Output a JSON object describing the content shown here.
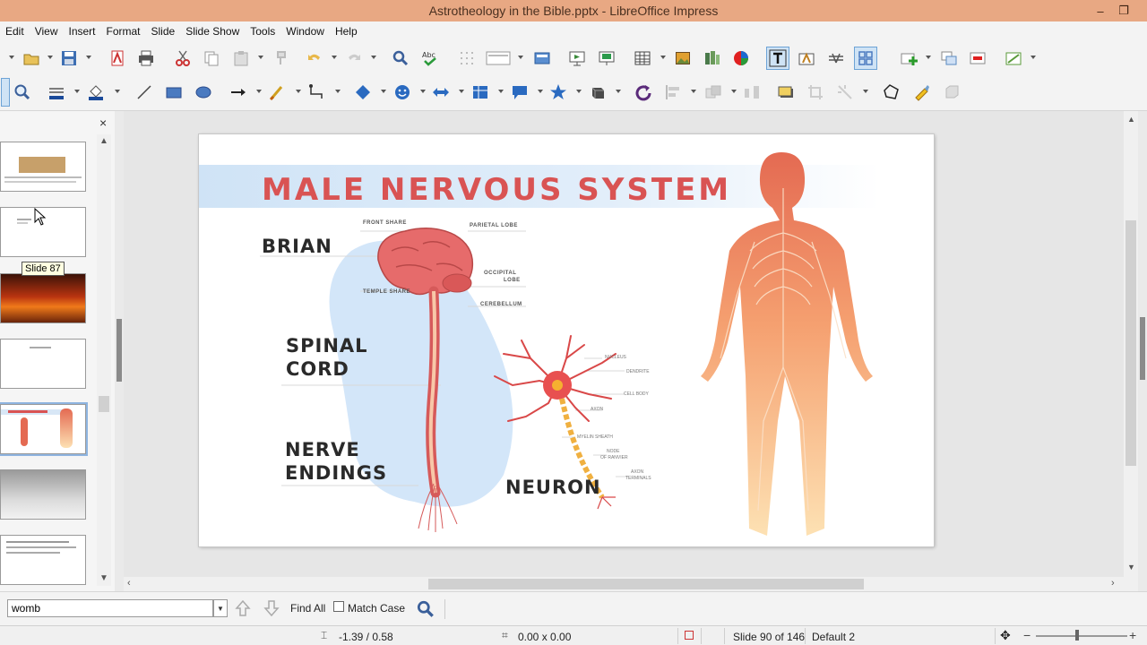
{
  "window": {
    "title": "Astrotheology in the Bible.pptx - LibreOffice Impress",
    "minimize": "–",
    "restore": "❐"
  },
  "menu": [
    "Edit",
    "View",
    "Insert",
    "Format",
    "Slide",
    "Slide Show",
    "Tools",
    "Window",
    "Help"
  ],
  "slide_panel": {
    "close": "×",
    "tooltip": "Slide 87"
  },
  "slide": {
    "heading": "MALE NERVOUS SYSTEM",
    "labels": {
      "brain": "BRIAN",
      "spinal_1": "SPINAL",
      "spinal_2": "CORD",
      "nerve_1": "NERVE",
      "nerve_2": "ENDINGS",
      "neuron": "NEURON"
    },
    "brain_parts": {
      "front": "FRONT SHARE",
      "parietal": "PARIETAL LOBE",
      "occipital_1": "OCCIPITAL",
      "occipital_2": "LOBE",
      "temple": "TEMPLE SHARE",
      "cerebellum": "CEREBELLUM"
    },
    "neuron_parts": {
      "nucleus": "NUCLEUS",
      "dendrite": "DENDRITE",
      "cell_body": "CELL BODY",
      "axon": "AXON",
      "myelin": "MYELIN SHEATH",
      "node_1": "NODE",
      "node_2": "OF RANVIER",
      "terminals_1": "AXON",
      "terminals_2": "TERMINALS"
    },
    "colors": {
      "heading": "#d95353",
      "banner": "#cfe3f6",
      "body_top": "#e46a52",
      "body_bottom": "#fde1b3"
    }
  },
  "find": {
    "value": "womb",
    "find_all": "Find All",
    "match_case": "Match Case"
  },
  "status": {
    "position": "-1.39 / 0.58",
    "size": "0.00 x 0.00",
    "slide": "Slide 90 of 146",
    "layout": "Default 2"
  }
}
